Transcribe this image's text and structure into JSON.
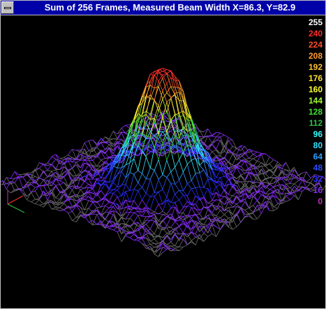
{
  "window": {
    "title": "Sum of 256 Frames, Measured Beam Width X=86.3, Y=82.9"
  },
  "legend": [
    {
      "value": "255",
      "color": "#ffffff"
    },
    {
      "value": "240",
      "color": "#ff2a2a"
    },
    {
      "value": "224",
      "color": "#ff4d2a"
    },
    {
      "value": "208",
      "color": "#ff9a30"
    },
    {
      "value": "192",
      "color": "#ffc030"
    },
    {
      "value": "176",
      "color": "#ffe030"
    },
    {
      "value": "160",
      "color": "#ffff30"
    },
    {
      "value": "144",
      "color": "#a0ff30"
    },
    {
      "value": "128",
      "color": "#40e030"
    },
    {
      "value": "112",
      "color": "#30c040"
    },
    {
      "value": "96",
      "color": "#30ffff"
    },
    {
      "value": "80",
      "color": "#30e0ff"
    },
    {
      "value": "64",
      "color": "#30a0ff"
    },
    {
      "value": "48",
      "color": "#2a4dff"
    },
    {
      "value": "32",
      "color": "#2a2aff"
    },
    {
      "value": "16",
      "color": "#8a2aff"
    },
    {
      "value": "0",
      "color": "#c030c0"
    }
  ],
  "chart_data": {
    "type": "surface",
    "frames": 256,
    "beam_width": {
      "x": 86.3,
      "y": 82.9
    },
    "zlim": [
      0,
      255
    ],
    "peak": 255
  }
}
